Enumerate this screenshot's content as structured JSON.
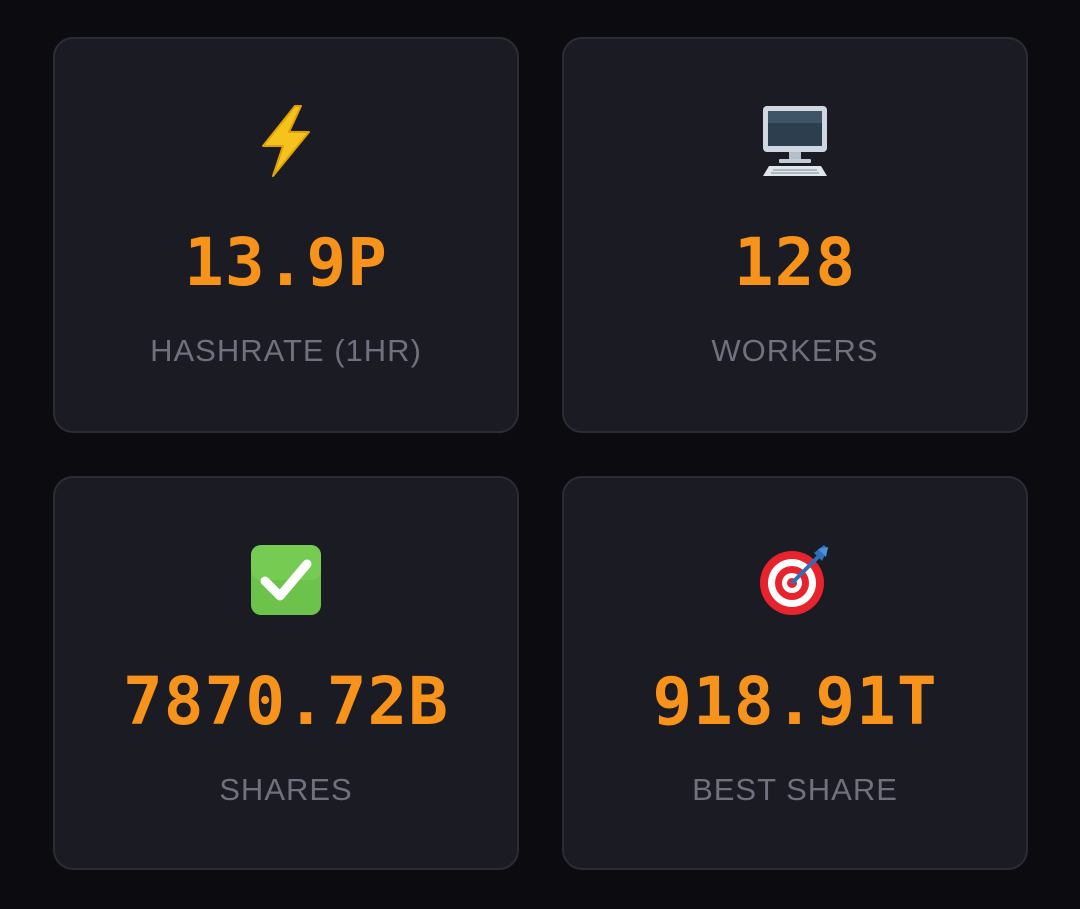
{
  "stats": [
    {
      "icon": "lightning-icon",
      "value": "13.9P",
      "label": "HASHRATE (1HR)"
    },
    {
      "icon": "desktop-computer-icon",
      "value": "128",
      "label": "WORKERS"
    },
    {
      "icon": "check-mark-icon",
      "value": "7870.72B",
      "label": "SHARES"
    },
    {
      "icon": "target-icon",
      "value": "918.91T",
      "label": "BEST SHARE"
    }
  ],
  "colors": {
    "page_background": "#0b0b10",
    "card_background": "#1b1b23",
    "card_border": "#2c2c38",
    "value": "#f7931a",
    "label": "#70707e",
    "check_green": "#6cc24a"
  }
}
